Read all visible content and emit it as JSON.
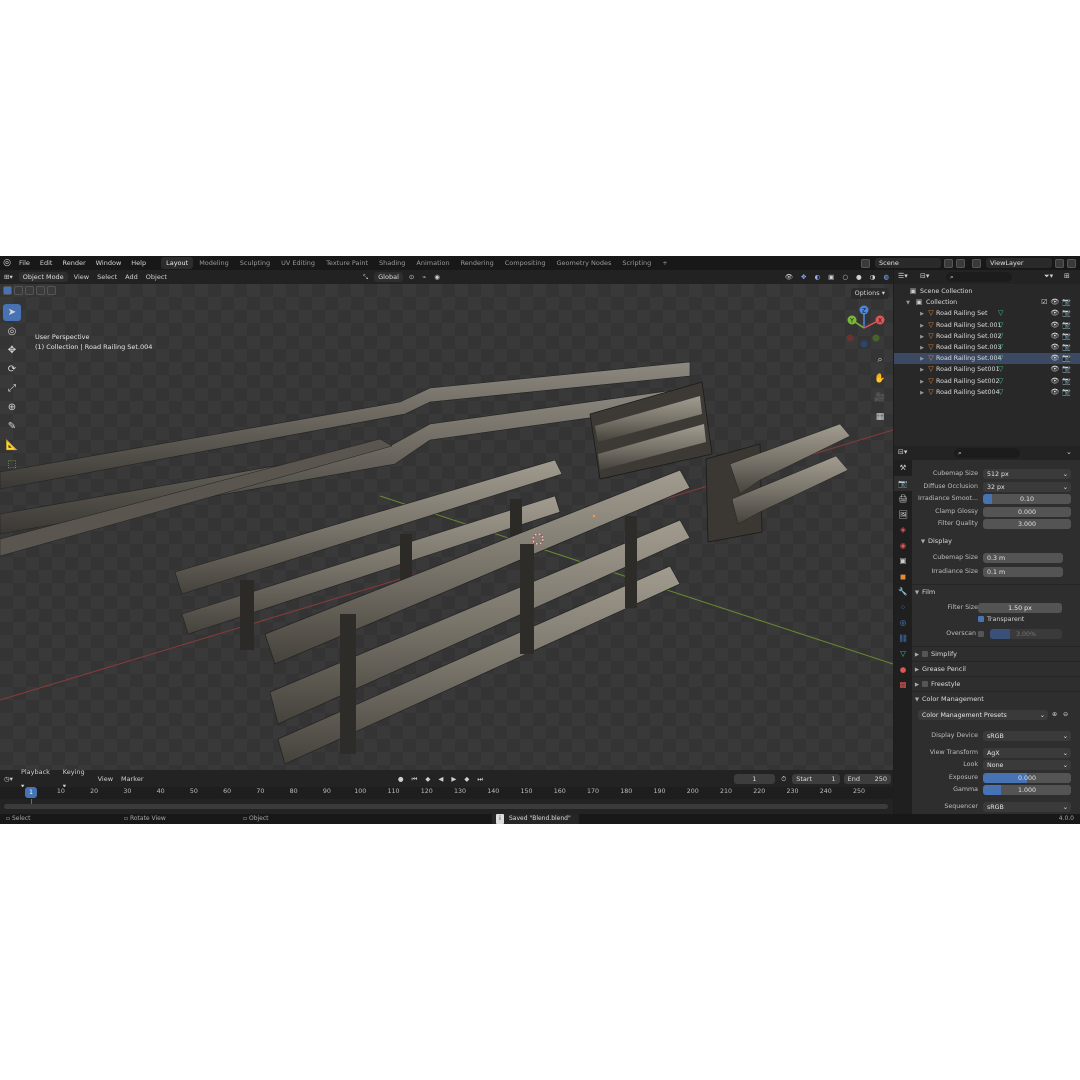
{
  "menu": {
    "items": [
      "File",
      "Edit",
      "Render",
      "Window",
      "Help"
    ]
  },
  "workspaces": [
    "Layout",
    "Modeling",
    "Sculpting",
    "UV Editing",
    "Texture Paint",
    "Shading",
    "Animation",
    "Rendering",
    "Compositing",
    "Geometry Nodes",
    "Scripting"
  ],
  "workspace_add": "+",
  "scene": {
    "name": "Scene",
    "view_layer": "ViewLayer"
  },
  "viewport_header": {
    "mode": "Object Mode",
    "view": "View",
    "select": "Select",
    "add": "Add",
    "object": "Object",
    "orientation": "Global",
    "options": "Options"
  },
  "viewport": {
    "perspective": "User Perspective",
    "collection_prefix": "(1) Collection",
    "separator": "|",
    "active_object": "Road Railing Set.004",
    "gizmo_axes": [
      "X",
      "Y",
      "Z"
    ]
  },
  "outliner": {
    "scene_collection": "Scene Collection",
    "collection": "Collection",
    "objects": [
      "Road Railing Set",
      "Road Railing Set.001",
      "Road Railing Set.002",
      "Road Railing Set.003",
      "Road Railing Set.004",
      "Road Railing Set001",
      "Road Railing Set002",
      "Road Railing Set004"
    ],
    "selected_index": 4
  },
  "properties": {
    "rows_top": [
      {
        "label": "Cubemap Size",
        "value": "512 px"
      },
      {
        "label": "Diffuse Occlusion",
        "value": "32 px"
      },
      {
        "label": "Irradiance Smoot...",
        "value": "0.10",
        "fill": 0.1
      },
      {
        "label": "Clamp Glossy",
        "value": "0.000"
      },
      {
        "label": "Filter Quality",
        "value": "3.000"
      }
    ],
    "display_section": "Display",
    "display_rows": [
      {
        "label": "Cubemap Size",
        "value": "0.3 m"
      },
      {
        "label": "Irradiance Size",
        "value": "0.1 m"
      }
    ],
    "film_section": "Film",
    "filter_size": {
      "label": "Filter Size",
      "value": "1.50 px"
    },
    "transparent": {
      "label": "Transparent",
      "checked": true
    },
    "overscan": {
      "label": "Overscan",
      "value": "3.00%"
    },
    "simplify": "Simplify",
    "grease_pencil": "Grease Pencil",
    "freestyle": "Freestyle",
    "color_management": "Color Management",
    "cm_presets": "Color Management Presets",
    "display_device": {
      "label": "Display Device",
      "value": "sRGB"
    },
    "view_transform": {
      "label": "View Transform",
      "value": "AgX"
    },
    "look": {
      "label": "Look",
      "value": "None"
    },
    "exposure": {
      "label": "Exposure",
      "value": "0.000",
      "fill": 0.5
    },
    "gamma": {
      "label": "Gamma",
      "value": "1.000",
      "fill": 0.2
    },
    "sequencer": {
      "label": "Sequencer",
      "value": "sRGB"
    }
  },
  "timeline": {
    "playback": "Playback",
    "keying": "Keying",
    "view": "View",
    "marker": "Marker",
    "current_frame": "1",
    "start_label": "Start",
    "start": "1",
    "end_label": "End",
    "end": "250",
    "ticks": [
      "10",
      "20",
      "30",
      "40",
      "50",
      "60",
      "70",
      "80",
      "90",
      "100",
      "110",
      "120",
      "130",
      "140",
      "150",
      "160",
      "170",
      "180",
      "190",
      "200",
      "210",
      "220",
      "230",
      "240",
      "250"
    ],
    "cursor": "1"
  },
  "status": {
    "select": "Select",
    "rotate_view": "Rotate View",
    "object": "Object",
    "saved": "Saved \"Blend.blend\"",
    "version": "4.0.0"
  },
  "colors": {
    "accent": "#4772b3",
    "object_icon": "#e5883a",
    "mesh_icon": "#42c28e"
  }
}
